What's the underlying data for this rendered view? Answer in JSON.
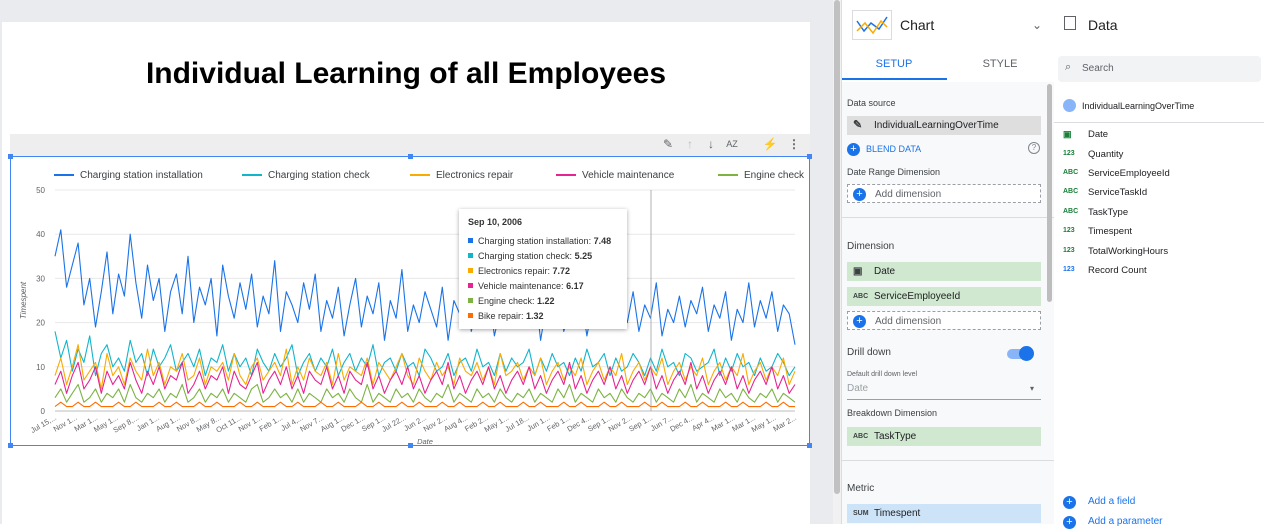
{
  "report": {
    "title": "Individual Learning of all Employees"
  },
  "toolbar": {
    "icons": [
      "pencil-icon",
      "arrow-up-icon",
      "arrow-down-icon",
      "sort-az-icon",
      "bolt-icon",
      "more-vert-icon"
    ],
    "sort_label": "AZ"
  },
  "chart_data": {
    "type": "line",
    "title": "",
    "xlabel": "Date",
    "ylabel": "Timespent",
    "ylim": [
      0,
      50
    ],
    "yticks": [
      0,
      10,
      20,
      30,
      40,
      50
    ],
    "grid": true,
    "legend_position": "top",
    "xtick_labels": [
      "Jul 15,...",
      "Nov 1...",
      "Mar 1...",
      "May 1...",
      "Sep 8,...",
      "Jan 1...",
      "Aug 1...",
      "Nov 8...",
      "May 8...",
      "Oct 11...",
      "Nov 1...",
      "Feb 1...",
      "Jul 4,...",
      "Nov 7...",
      "Aug 1...",
      "Dec 1...",
      "Sep 1...",
      "Jul 22...",
      "Jun 2...",
      "Nov 2...",
      "Aug 4...",
      "Feb 2...",
      "May 1...",
      "Jul 18...",
      "Jun 1...",
      "Feb 1...",
      "Dec 4...",
      "Sep 1...",
      "Nov 2...",
      "Sep 1...",
      "Jun 7...",
      "Dec 4...",
      "Apr 4...",
      "Mar 1...",
      "Mar 1...",
      "May 1...",
      "Mar 2..."
    ],
    "series": [
      {
        "name": "Charging station installation",
        "color": "#1a73e8",
        "values": [
          35,
          41,
          28,
          33,
          38,
          24,
          30,
          19,
          27,
          36,
          22,
          31,
          26,
          40,
          29,
          21,
          33,
          25,
          30,
          18,
          27,
          31,
          22,
          35,
          20,
          28,
          24,
          30,
          17,
          33,
          26,
          21,
          29,
          23,
          31,
          19,
          26,
          22,
          34,
          18,
          27,
          24,
          20,
          29,
          23,
          31,
          18,
          25,
          21,
          28,
          17,
          24,
          30,
          19,
          26,
          22,
          29,
          16,
          25,
          21,
          32,
          18,
          24,
          20,
          27,
          23,
          19,
          28,
          16,
          25,
          22,
          30,
          18,
          24,
          21,
          27,
          17,
          23,
          20,
          29,
          19,
          25,
          22,
          28,
          16,
          24,
          21,
          27,
          18,
          23,
          20,
          26,
          17,
          24,
          21,
          28,
          19,
          22,
          25,
          20,
          27,
          18,
          24,
          21,
          29,
          17,
          23,
          20,
          26,
          19,
          25,
          22,
          28,
          18,
          24,
          21,
          27,
          16,
          23,
          20,
          29,
          19,
          25,
          21,
          27,
          18,
          24,
          22,
          15
        ]
      },
      {
        "name": "Charging station check",
        "color": "#12b5cb",
        "values": [
          18,
          12,
          16,
          9,
          14,
          11,
          17,
          8,
          13,
          15,
          10,
          12,
          9,
          16,
          11,
          13,
          8,
          14,
          10,
          12,
          15,
          9,
          11,
          13,
          10,
          14,
          8,
          12,
          11,
          15,
          9,
          13,
          10,
          12,
          8,
          14,
          11,
          9,
          13,
          10,
          12,
          15,
          8,
          11,
          13,
          9,
          12,
          10,
          14,
          8,
          11,
          13,
          9,
          12,
          10,
          15,
          8,
          11,
          12,
          9,
          13,
          10,
          11,
          8,
          14,
          12,
          9,
          10,
          13,
          8,
          11,
          12,
          9,
          14,
          10,
          11,
          8,
          13,
          9,
          12,
          10,
          11,
          14,
          8,
          12,
          9,
          13,
          10,
          11,
          8,
          12,
          9,
          14,
          10,
          11,
          13,
          8,
          12,
          9,
          10,
          13,
          11,
          8,
          12,
          9,
          14,
          10,
          11,
          8,
          13,
          12,
          9,
          10,
          11,
          14,
          8,
          12,
          9,
          13,
          10,
          11,
          8,
          12,
          9,
          10,
          13,
          11,
          8,
          10
        ]
      },
      {
        "name": "Electronics repair",
        "color": "#f9ab00",
        "values": [
          8,
          12,
          6,
          10,
          15,
          7,
          9,
          11,
          5,
          13,
          8,
          10,
          6,
          12,
          9,
          7,
          14,
          8,
          11,
          6,
          10,
          9,
          13,
          7,
          8,
          12,
          6,
          10,
          9,
          11,
          7,
          13,
          8,
          6,
          10,
          12,
          7,
          9,
          11,
          8,
          14,
          6,
          10,
          7,
          12,
          9,
          8,
          11,
          6,
          13,
          7,
          10,
          9,
          8,
          12,
          6,
          11,
          9,
          7,
          10,
          13,
          8,
          6,
          12,
          9,
          7,
          11,
          8,
          10,
          6,
          12,
          9,
          8,
          11,
          7,
          10,
          6,
          13,
          8,
          9,
          11,
          7,
          10,
          8,
          12,
          6,
          9,
          11,
          7,
          10,
          8,
          12,
          6,
          9,
          11,
          7,
          10,
          8,
          13,
          6,
          9,
          11,
          7,
          10,
          8,
          12,
          6,
          9,
          11,
          7,
          10,
          8,
          12,
          6,
          9,
          11,
          7,
          10,
          8,
          13,
          6,
          9,
          11,
          7,
          10,
          8,
          12,
          6,
          9
        ]
      },
      {
        "name": "Vehicle maintenance",
        "color": "#e52592",
        "values": [
          6,
          9,
          4,
          8,
          11,
          5,
          7,
          10,
          4,
          9,
          6,
          8,
          5,
          11,
          7,
          4,
          9,
          6,
          10,
          5,
          8,
          7,
          11,
          4,
          6,
          9,
          5,
          8,
          7,
          10,
          4,
          9,
          6,
          5,
          8,
          11,
          4,
          7,
          9,
          6,
          10,
          5,
          8,
          4,
          9,
          7,
          6,
          10,
          5,
          8,
          4,
          9,
          7,
          6,
          11,
          5,
          8,
          4,
          7,
          9,
          6,
          10,
          5,
          8,
          4,
          7,
          9,
          6,
          11,
          5,
          8,
          4,
          7,
          9,
          6,
          10,
          5,
          8,
          4,
          7,
          9,
          6,
          10,
          5,
          8,
          4,
          7,
          9,
          6,
          11,
          5,
          8,
          4,
          7,
          9,
          6,
          10,
          5,
          8,
          4,
          7,
          9,
          6,
          10,
          5,
          8,
          4,
          7,
          9,
          6,
          11,
          5,
          8,
          4,
          7,
          9,
          6,
          10,
          5,
          8,
          4,
          7,
          9,
          6,
          10,
          5,
          8,
          4,
          6
        ]
      },
      {
        "name": "Engine check",
        "color": "#7cb342",
        "values": [
          3,
          5,
          2,
          4,
          6,
          2,
          3,
          5,
          2,
          4,
          3,
          5,
          2,
          6,
          3,
          2,
          4,
          3,
          5,
          2,
          4,
          3,
          6,
          2,
          3,
          5,
          2,
          4,
          3,
          5,
          2,
          4,
          3,
          2,
          5,
          6,
          2,
          3,
          5,
          3,
          4,
          2,
          5,
          2,
          4,
          3,
          2,
          5,
          3,
          4,
          2,
          5,
          3,
          2,
          6,
          2,
          4,
          3,
          2,
          5,
          3,
          4,
          2,
          5,
          3,
          2,
          4,
          3,
          6,
          2,
          4,
          3,
          2,
          5,
          3,
          4,
          2,
          5,
          3,
          2,
          4,
          3,
          5,
          2,
          4,
          3,
          2,
          5,
          3,
          6,
          2,
          4,
          3,
          2,
          5,
          3,
          4,
          2,
          5,
          3,
          2,
          4,
          3,
          5,
          2,
          4,
          3,
          2,
          5,
          3,
          6,
          2,
          4,
          3,
          2,
          5,
          3,
          4,
          2,
          5,
          3,
          2,
          4,
          3,
          5,
          2,
          4,
          3,
          2
        ]
      },
      {
        "name": "Bike repair",
        "color": "#ff6d00",
        "values": [
          1,
          2,
          1,
          1,
          2,
          1,
          1,
          2,
          1,
          1,
          1,
          2,
          1,
          1,
          2,
          1,
          1,
          1,
          2,
          1,
          1,
          2,
          1,
          1,
          1,
          2,
          1,
          1,
          2,
          1,
          1,
          1,
          2,
          1,
          1,
          2,
          1,
          1,
          1,
          2,
          1,
          1,
          2,
          1,
          1,
          1,
          2,
          1,
          1,
          2,
          1,
          1,
          1,
          2,
          1,
          1,
          2,
          1,
          1,
          1,
          2,
          1,
          1,
          2,
          1,
          1,
          1,
          2,
          1,
          1,
          2,
          1,
          1,
          1,
          2,
          1,
          1,
          2,
          1,
          1,
          1,
          2,
          1,
          1,
          2,
          1,
          1,
          1,
          2,
          1,
          1,
          2,
          1,
          1,
          1,
          2,
          1,
          1,
          2,
          1,
          1,
          1,
          2,
          1,
          1,
          2,
          1,
          1,
          1,
          2,
          1,
          1,
          2,
          1,
          1,
          1,
          2,
          1,
          1,
          2,
          1,
          1,
          1,
          2,
          1,
          1,
          2,
          1,
          1
        ]
      }
    ],
    "tooltip": {
      "title": "Sep 10, 2006",
      "rows": [
        {
          "label": "Charging station installation: ",
          "value": "7.48",
          "color": "#1a73e8"
        },
        {
          "label": "Charging station check: ",
          "value": "5.25",
          "color": "#12b5cb"
        },
        {
          "label": "Electronics repair: ",
          "value": "7.72",
          "color": "#f9ab00"
        },
        {
          "label": "Vehicle maintenance: ",
          "value": "6.17",
          "color": "#e52592"
        },
        {
          "label": "Engine check: ",
          "value": "1.22",
          "color": "#7cb342"
        },
        {
          "label": "Bike repair: ",
          "value": "1.32",
          "color": "#ff6d00"
        }
      ]
    }
  },
  "setup": {
    "chart_type": "Chart",
    "chart_type_icon": "line-chart-icon",
    "tabs": [
      "SETUP",
      "STYLE"
    ],
    "data_source_label": "Data source",
    "data_source": "IndividualLearningOverTime",
    "blend_label": "BLEND DATA",
    "date_range_label": "Date Range Dimension",
    "add_dimension": "Add dimension",
    "dimension_label": "Dimension",
    "dimensions": [
      {
        "type": "date",
        "name": "Date"
      },
      {
        "type": "ABC",
        "name": "ServiceEmployeeId"
      }
    ],
    "drill_down_label": "Drill down",
    "drill_default_label": "Default drill down level",
    "drill_default_value": "Date",
    "breakdown_label": "Breakdown Dimension",
    "breakdown": {
      "type": "ABC",
      "name": "TaskType"
    },
    "metric_label": "Metric",
    "metric": {
      "agg": "SUM",
      "name": "Timespent"
    }
  },
  "data_panel": {
    "title": "Data",
    "search_placeholder": "Search",
    "source": "IndividualLearningOverTime",
    "fields": [
      {
        "type": "date",
        "name": "Date",
        "color": "#188038"
      },
      {
        "type": "123",
        "name": "Quantity",
        "color": "#188038"
      },
      {
        "type": "ABC",
        "name": "ServiceEmployeeId",
        "color": "#188038"
      },
      {
        "type": "ABC",
        "name": "ServiceTaskId",
        "color": "#188038"
      },
      {
        "type": "ABC",
        "name": "TaskType",
        "color": "#188038"
      },
      {
        "type": "123",
        "name": "Timespent",
        "color": "#188038"
      },
      {
        "type": "123",
        "name": "TotalWorkingHours",
        "color": "#188038"
      },
      {
        "type": "123",
        "name": "Record Count",
        "color": "#1a73e8"
      }
    ],
    "add_field": "Add a field",
    "add_parameter": "Add a parameter"
  }
}
